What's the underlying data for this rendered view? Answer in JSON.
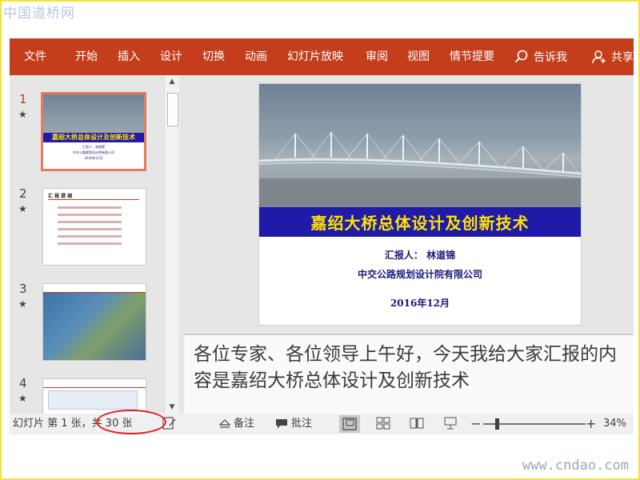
{
  "watermarks": {
    "top": "中国道桥网",
    "bottom": "www.cndao.com"
  },
  "ribbon": {
    "tabs": [
      "文件",
      "开始",
      "插入",
      "设计",
      "切换",
      "动画",
      "幻灯片放映",
      "审阅",
      "视图",
      "情节提要"
    ],
    "tell_me": "告诉我",
    "share": "共享"
  },
  "thumbnails": [
    {
      "number": "1",
      "title": "嘉绍大桥总体设计及创新技术",
      "line1": "汇报人：林道锦",
      "line2": "中交公路规划设计院有限公司",
      "line3": "2016年12月"
    },
    {
      "number": "2",
      "title": "汇 报 提 纲"
    },
    {
      "number": "3"
    },
    {
      "number": "4"
    }
  ],
  "slide": {
    "title": "嘉绍大桥总体设计及创新技术",
    "reporter": "汇报人：  林道锦",
    "company": "中交公路规划设计院有限公司",
    "date": "2016年12月"
  },
  "notes": "各位专家、各位领导上午好，今天我给大家汇报的内容是嘉绍大桥总体设计及创新技术",
  "status": {
    "slide_indicator": "幻灯片 第 1 张，共 30 张",
    "notes_label": "备注",
    "comments_label": "批注",
    "zoom_percent": 34
  },
  "colors": {
    "ribbon": "#c43e1c",
    "slide_title_bar": "#1f1aa8",
    "slide_title_text": "#ffe400",
    "highlight_ring": "#e02020"
  }
}
